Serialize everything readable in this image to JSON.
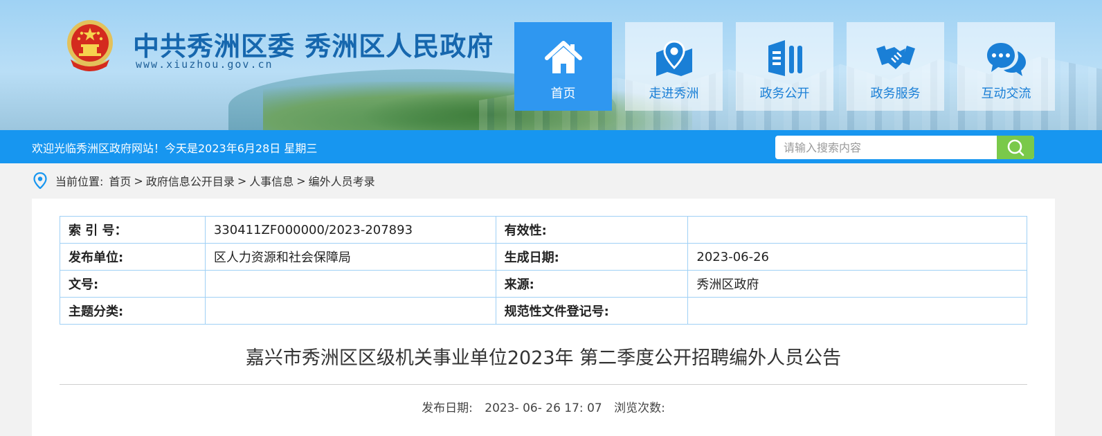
{
  "header": {
    "site_title": "中共秀洲区委 秀洲区人民政府",
    "site_url": "www.xiuzhou.gov.cn"
  },
  "nav": {
    "items": [
      {
        "label": "首页",
        "icon": "home-icon",
        "active": true
      },
      {
        "label": "走进秀洲",
        "icon": "map-pin-icon",
        "active": false
      },
      {
        "label": "政务公开",
        "icon": "document-icon",
        "active": false
      },
      {
        "label": "政务服务",
        "icon": "handshake-icon",
        "active": false
      },
      {
        "label": "互动交流",
        "icon": "chat-icon",
        "active": false
      }
    ]
  },
  "welcome_bar": {
    "message": "欢迎光临秀洲区政府网站！今天是2023年6月28日 星期三",
    "search_placeholder": "请输入搜索内容"
  },
  "breadcrumb": {
    "prefix": "当前位置:",
    "items": [
      "首页",
      "政府信息公开目录",
      "人事信息",
      "编外人员考录"
    ]
  },
  "meta_table": {
    "rows": [
      {
        "k1": "索 引 号：",
        "v1": "330411ZF000000/2023-207893",
        "k2": "有效性:",
        "v2": ""
      },
      {
        "k1": "发布单位:",
        "v1": "区人力资源和社会保障局",
        "k2": "生成日期:",
        "v2": "2023-06-26"
      },
      {
        "k1": "文号:",
        "v1": "",
        "k2": "来源:",
        "v2": "秀洲区政府"
      },
      {
        "k1": "主题分类:",
        "v1": "",
        "k2": "规范性文件登记号:",
        "v2": ""
      }
    ]
  },
  "article": {
    "title": "嘉兴市秀洲区区级机关事业单位2023年 第二季度公开招聘编外人员公告",
    "publish_label": "发布日期:",
    "publish_date": "2023- 06- 26 17: 07",
    "views_label": "浏览次数:"
  },
  "colors": {
    "primary_blue": "#1796f0",
    "active_nav": "#2f97f0",
    "search_button": "#7ac94a",
    "title_blue": "#1667ae"
  }
}
